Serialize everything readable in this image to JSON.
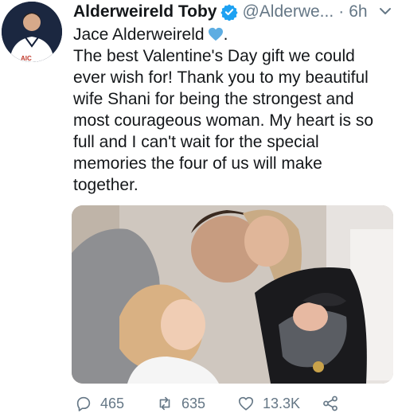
{
  "tweet": {
    "author_name": "Alderweireld Toby",
    "handle": "@Alderwe...",
    "separator": "·",
    "time": "6h",
    "text_line1": "Jace Alderweireld",
    "text_line1_suffix": ".",
    "text_body": "The best Valentine's Day gift we could ever wish for! Thank you to my beautiful wife Shani for being the strongest and most courageous woman. My heart is so full and I can't wait for the special memories the four of us will make together.",
    "heart_icon": "blue-heart-emoji"
  },
  "actions": {
    "replies": "465",
    "retweets": "635",
    "likes": "13.3K"
  },
  "colors": {
    "verified": "#1da1f2",
    "heart": "#5dade2",
    "muted": "#657786"
  }
}
